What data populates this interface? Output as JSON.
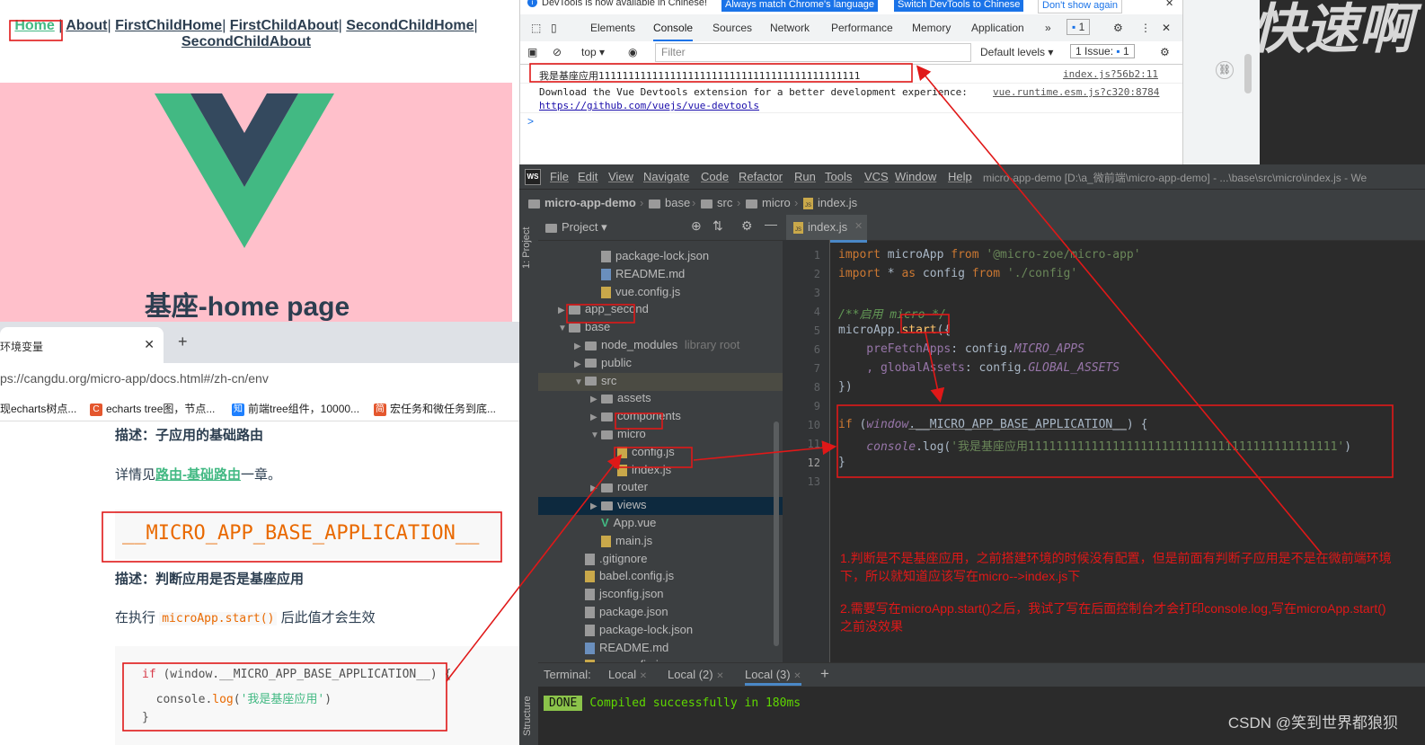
{
  "vue_app": {
    "nav": [
      "Home",
      "About",
      "FirstChildHome",
      "FirstChildAbout",
      "SecondChildHome",
      "SecondChildAbout"
    ],
    "title": "基座-home page"
  },
  "docs_browser": {
    "tab_title": "环境变量",
    "url": "ps://cangdu.org/micro-app/docs.html#/zh-cn/env",
    "url_host": "cangdu.org",
    "bookmarks": [
      "现echarts树点...",
      "echarts tree图，节点...",
      "前端tree组件，10000...",
      "宏任务和微任务到底..."
    ],
    "desc1": "描述：子应用的基础路由",
    "desc1_more_prefix": "详情见",
    "desc1_more_link": "路由-基础路由",
    "desc1_more_suffix": "一章。",
    "big_code": "__MICRO_APP_BASE_APPLICATION__",
    "desc2": "描述：判断应用是否是基座应用",
    "desc2_prefix": "在执行",
    "desc2_code": "microApp.start()",
    "desc2_suffix": "后此值才会生效",
    "code_lines": [
      "if (window.__MICRO_APP_BASE_APPLICATION__) {",
      "  console.log('我是基座应用')",
      "}"
    ]
  },
  "devtools": {
    "info_text": "DevTools is now available in Chinese!",
    "info_btn1": "Always match Chrome's language",
    "info_btn2": "Switch DevTools to Chinese",
    "info_btn3": "Don't show again",
    "tabs": [
      "Elements",
      "Console",
      "Sources",
      "Network",
      "Performance",
      "Memory",
      "Application"
    ],
    "active_tab": "Console",
    "issues_badge": "1",
    "context": "top",
    "filter_placeholder": "Filter",
    "levels": "Default levels",
    "issue_count": "1 Issue:",
    "issue_num": "1",
    "log1": "我是基座应用11111111111111111111111111111111111111111111",
    "log1_src": "index.js?56b2:11",
    "log2": "Download the Vue Devtools extension for a better development experience:",
    "log2_link": "https://github.com/vuejs/vue-devtools",
    "log2_src": "vue.runtime.esm.js?c320:8784",
    "prompt": ">"
  },
  "ide": {
    "logo": "WS",
    "menu": [
      "File",
      "Edit",
      "View",
      "Navigate",
      "Code",
      "Refactor",
      "Run",
      "Tools",
      "VCS",
      "Window",
      "Help"
    ],
    "window_title": "micro-app-demo [D:\\a_微前端\\micro-app-demo] - ...\\base\\src\\micro\\index.js - We",
    "breadcrumbs": [
      "micro-app-demo",
      "base",
      "src",
      "micro",
      "index.js"
    ],
    "project_label": "Project",
    "side_label": "1: Project",
    "structure_label": "Structure",
    "tree": [
      {
        "label": "package-lock.json",
        "kind": "json",
        "depth": 3
      },
      {
        "label": "README.md",
        "kind": "md",
        "depth": 3
      },
      {
        "label": "vue.config.js",
        "kind": "js",
        "depth": 3
      },
      {
        "label": "app_second",
        "kind": "folder",
        "depth": 1,
        "arrow": "▶"
      },
      {
        "label": "base",
        "kind": "folder",
        "depth": 1,
        "arrow": "▼"
      },
      {
        "label": "node_modules",
        "extra": "library root",
        "kind": "folder",
        "depth": 2,
        "arrow": "▶"
      },
      {
        "label": "public",
        "kind": "folder",
        "depth": 2,
        "arrow": "▶"
      },
      {
        "label": "src",
        "kind": "folder",
        "depth": 2,
        "arrow": "▼"
      },
      {
        "label": "assets",
        "kind": "folder",
        "depth": 3,
        "arrow": "▶"
      },
      {
        "label": "components",
        "kind": "folder",
        "depth": 3,
        "arrow": "▶"
      },
      {
        "label": "micro",
        "kind": "folder",
        "depth": 3,
        "arrow": "▼"
      },
      {
        "label": "config.js",
        "kind": "js",
        "depth": 4
      },
      {
        "label": "index.js",
        "kind": "js",
        "depth": 4
      },
      {
        "label": "router",
        "kind": "folder",
        "depth": 3,
        "arrow": "▶"
      },
      {
        "label": "views",
        "kind": "folder",
        "depth": 3,
        "arrow": "▶"
      },
      {
        "label": "App.vue",
        "kind": "vue",
        "depth": 3
      },
      {
        "label": "main.js",
        "kind": "js",
        "depth": 3
      },
      {
        "label": ".gitignore",
        "kind": "file",
        "depth": 2
      },
      {
        "label": "babel.config.js",
        "kind": "js",
        "depth": 2
      },
      {
        "label": "jsconfig.json",
        "kind": "json",
        "depth": 2
      },
      {
        "label": "package.json",
        "kind": "json",
        "depth": 2
      },
      {
        "label": "package-lock.json",
        "kind": "json",
        "depth": 2
      },
      {
        "label": "README.md",
        "kind": "md",
        "depth": 2
      },
      {
        "label": "vue.config.js",
        "kind": "js",
        "depth": 2
      }
    ],
    "editor_tab": "index.js",
    "line_numbers": [
      "1",
      "2",
      "3",
      "4",
      "5",
      "6",
      "7",
      "8",
      "9",
      "10",
      "11",
      "12",
      "13"
    ],
    "code": {
      "l1_a": "import",
      "l1_b": " microApp ",
      "l1_c": "from",
      "l1_d": " '@micro-zoe/micro-app'",
      "l2_a": "import",
      "l2_b": " * ",
      "l2_c": "as",
      "l2_d": " config ",
      "l2_e": "from",
      "l2_f": " './config'",
      "l4": "/**启用 micro */",
      "l5_a": "microApp.",
      "l5_b": "start",
      "l5_c": "({",
      "l6_a": "    preFetchApps",
      "l6_b": ": config.",
      "l6_c": "MICRO_APPS",
      "l7_a": "    , globalAssets",
      "l7_b": ": config.",
      "l7_c": "GLOBAL_ASSETS",
      "l8": "})",
      "l10_a": "if",
      "l10_b": " (",
      "l10_c": "window",
      "l10_d": ".__MICRO_APP_BASE_APPLICATION__",
      "l10_e": ") {",
      "l11_a": "    console",
      "l11_b": ".log(",
      "l11_c": "'我是基座应用11111111111111111111111111111111111111111111'",
      "l11_d": ")",
      "l12": "}"
    },
    "annotation1": "1.判断是不是基座应用，之前搭建环境的时候没有配置，但是前面有判断子应用是不是在微前端环境下，所以就知道应该写在micro-->index.js下",
    "annotation2": "2.需要写在microApp.start()之后，我试了写在后面控制台才会打印console.log,写在microApp.start()之前没效果",
    "terminal_label": "Terminal:",
    "terminal_tabs": [
      "Local",
      "Local (2)",
      "Local (3)"
    ],
    "terminal_add": "+",
    "done": "DONE",
    "compiled": "Compiled successfully in 180ms"
  },
  "watermark": "CSDN @笑到世界都狼狈",
  "bg_chars": "快速啊",
  "colors": {
    "annotation_red": "#e01818",
    "vue_green": "#42b983",
    "vue_dark": "#34495e",
    "pink": "#ffc0cb"
  }
}
